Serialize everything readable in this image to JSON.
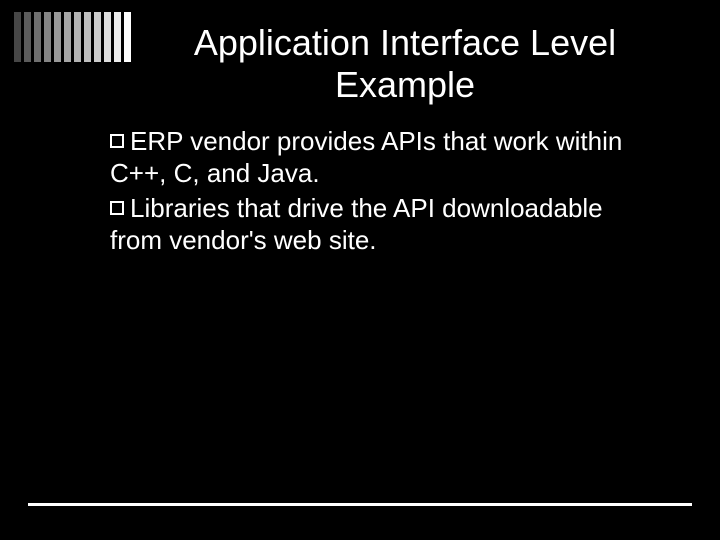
{
  "slide": {
    "title": "Application Interface Level Example",
    "bullets": [
      "ERP vendor provides APIs that work within C++, C, and Java.",
      "Libraries that drive the API downloadable from vendor's web site."
    ]
  }
}
